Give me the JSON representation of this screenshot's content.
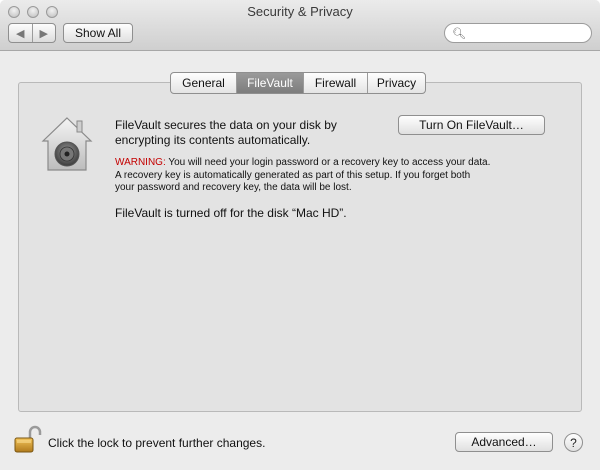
{
  "window": {
    "title": "Security & Privacy"
  },
  "toolbar": {
    "back_glyph": "◀",
    "forward_glyph": "▶",
    "show_all_label": "Show All",
    "search_placeholder": "",
    "search_icon": "magnifier-icon"
  },
  "tabs": [
    {
      "label": "General",
      "active": false
    },
    {
      "label": "FileVault",
      "active": true
    },
    {
      "label": "Firewall",
      "active": false
    },
    {
      "label": "Privacy",
      "active": false
    }
  ],
  "filevault": {
    "description_line1": "FileVault secures the data on your disk by",
    "description_line2": "encrypting its contents automatically.",
    "turn_on_label": "Turn On FileVault…",
    "warning_label": "WARNING:",
    "warning_line1": " You will need your login password or a recovery key to access your data.",
    "warning_line2": "A recovery key is automatically generated as part of this setup. If you forget both",
    "warning_line3": "your password and recovery key, the data will be lost.",
    "status": "FileVault is turned off for the disk “Mac HD”."
  },
  "footer": {
    "lock_text": "Click the lock to prevent further changes.",
    "advanced_label": "Advanced…",
    "help_label": "?"
  },
  "colors": {
    "warning": "#c40000",
    "active_tab": "#8a8a8a"
  }
}
